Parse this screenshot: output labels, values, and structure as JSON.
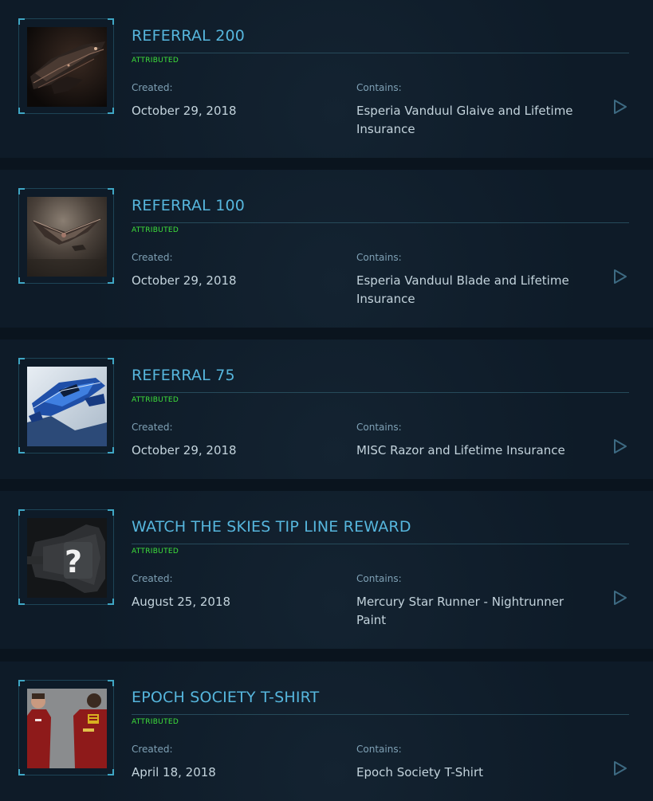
{
  "labels": {
    "created": "Created:",
    "contains": "Contains:"
  },
  "colors": {
    "title": "#56b6dd",
    "status": "#3ee03a",
    "frame_corner": "#3fa7c5",
    "background": "#0a141e"
  },
  "items": [
    {
      "title": "REFERRAL 200",
      "status": "ATTRIBUTED",
      "created": "October 29, 2018",
      "contains": "Esperia Vanduul Glaive and Lifetime Insurance",
      "image": "vanduul-glaive-ship-image",
      "action_icon": "play-triangle-icon"
    },
    {
      "title": "REFERRAL 100",
      "status": "ATTRIBUTED",
      "created": "October 29, 2018",
      "contains": "Esperia Vanduul Blade and Lifetime Insurance",
      "image": "vanduul-blade-ship-image",
      "action_icon": "play-triangle-icon"
    },
    {
      "title": "REFERRAL 75",
      "status": "ATTRIBUTED",
      "created": "October 29, 2018",
      "contains": "MISC Razor and Lifetime Insurance",
      "image": "misc-razor-ship-image",
      "action_icon": "play-triangle-icon"
    },
    {
      "title": "WATCH THE SKIES TIP LINE REWARD",
      "status": "ATTRIBUTED",
      "created": "August 25, 2018",
      "contains": "Mercury Star Runner - Nightrunner Paint",
      "image": "mystery-ship-question-mark-image",
      "action_icon": "play-triangle-icon"
    },
    {
      "title": "EPOCH SOCIETY T-SHIRT",
      "status": "ATTRIBUTED",
      "created": "April 18, 2018",
      "contains": "Epoch Society T-Shirt",
      "image": "epoch-society-tshirt-image",
      "action_icon": "play-triangle-icon"
    }
  ]
}
